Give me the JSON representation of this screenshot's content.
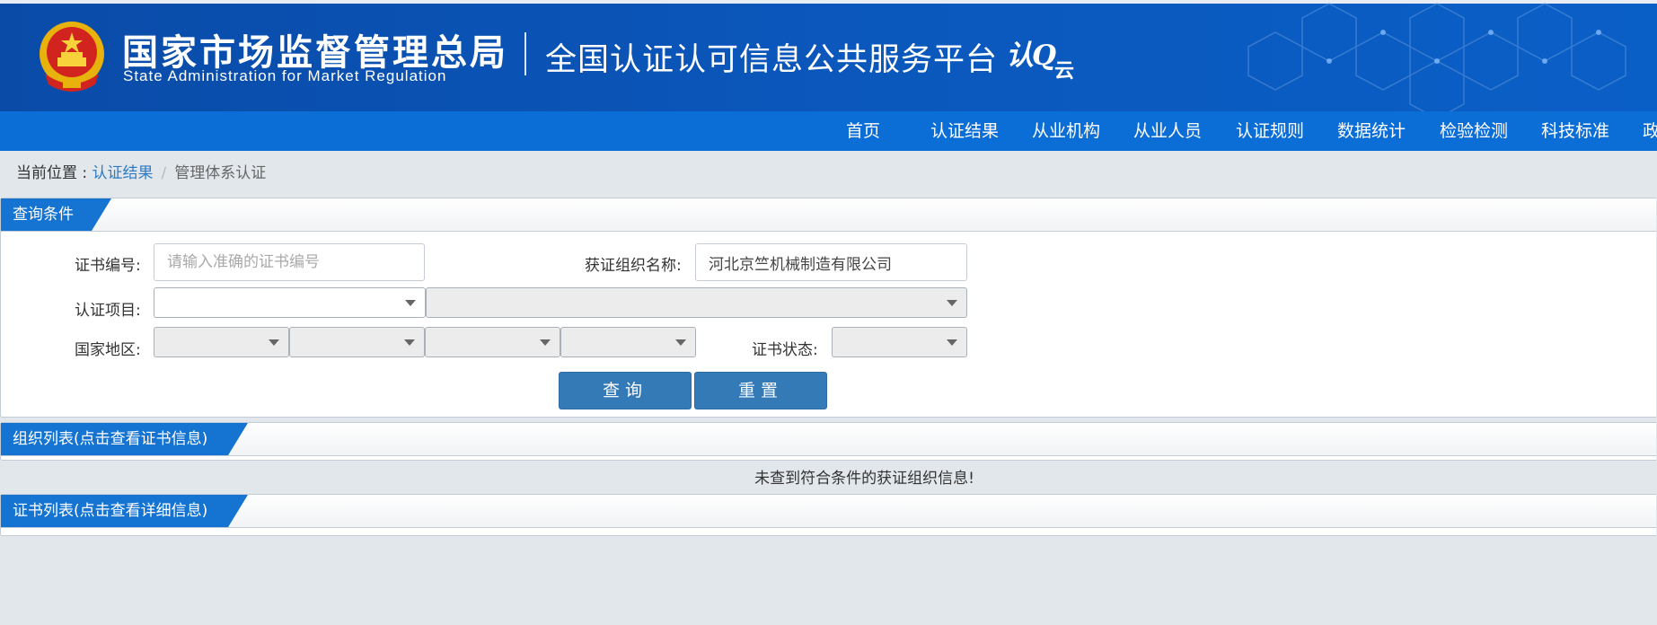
{
  "header": {
    "agency_cn": "国家市场监督管理总局",
    "agency_en": "State Administration  for  Market Regulation",
    "platform_title": "全国认证认可信息公共服务平台",
    "brand_logo_part1": "认",
    "brand_logo_part2": "云",
    "emblem_icon": "national-emblem-icon",
    "colors": {
      "header_bg": "#0b58bd",
      "nav_bg": "#0b6dd6"
    }
  },
  "nav": {
    "items": [
      "首页",
      "认证结果",
      "从业机构",
      "从业人员",
      "认证规则",
      "数据统计",
      "检验检测",
      "科技标准",
      "政"
    ]
  },
  "breadcrumb": {
    "prefix": "当前位置 : ",
    "link": "认证结果",
    "separator": "/",
    "current": "管理体系认证"
  },
  "query_panel": {
    "title": "查询条件",
    "cert_no_label": "证书编号:",
    "cert_no_placeholder": "请输入准确的证书编号",
    "org_name_label": "获证组织名称:",
    "org_name_value": "河北京竺机械制造有限公司",
    "cert_project_label": "认证项目:",
    "region_label": "国家地区:",
    "cert_status_label": "证书状态:",
    "search_button": "查询",
    "reset_button": "重置",
    "accent_color": "#337ab7"
  },
  "org_list": {
    "title": "组织列表(点击查看证书信息)",
    "empty_message": "未查到符合条件的获证组织信息!"
  },
  "cert_list": {
    "title": "证书列表(点击查看详细信息)"
  }
}
